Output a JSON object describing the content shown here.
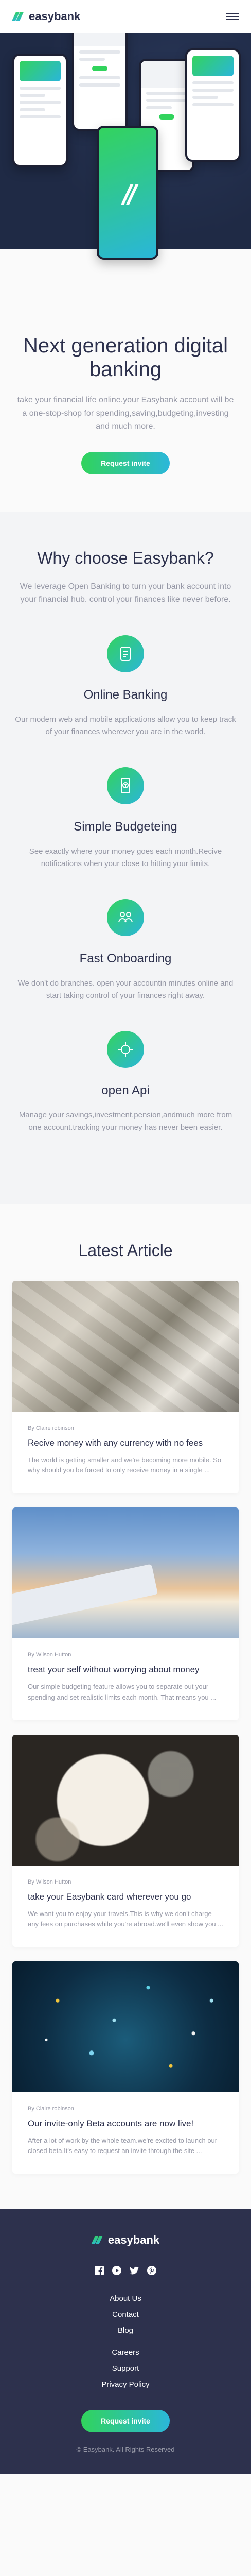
{
  "header": {
    "logo_text": "easybank",
    "menu_icon": "hamburger-menu-icon"
  },
  "hero": {
    "title": "Next generation digital banking",
    "description": "take your financial life online.your Easybank account will be a one-stop-shop for spending,saving,budgeting,investing and much more.",
    "cta_label": "Request invite"
  },
  "why": {
    "title": "Why choose Easybank?",
    "description": "We leverage Open Banking to turn your bank account into your financial hub. control your finances like never before.",
    "features": [
      {
        "icon": "online-banking-icon",
        "title": "Online Banking",
        "text": "Our modern web and mobile applications allow you to keep track of your finances wherever you are in the world."
      },
      {
        "icon": "budgeting-icon",
        "title": "Simple Budgeteing",
        "text": "See exactly where your money goes each month.Recive notifications when your close to hitting your limits."
      },
      {
        "icon": "onboarding-icon",
        "title": "Fast Onboarding",
        "text": "We don't do branches. open your accountin minutes online and start taking control of your finances right away."
      },
      {
        "icon": "api-icon",
        "title": "open Api",
        "text": "Manage your savings,investment,pension,andmuch more from one account.tracking your money has never been easier."
      }
    ]
  },
  "articles": {
    "title": "Latest Article",
    "items": [
      {
        "author": "By Claire robinson",
        "title": "Recive money with any currency with no fees",
        "text": "The world is getting smaller and we're becoming more mobile. So why should you be forced to only receive money in a single ..."
      },
      {
        "author": "By Wilson Hutton",
        "title": "treat your self without worrying about money",
        "text": "Our simple budgeting feature allows you to separate out your spending and set realistic limits each month. That means you ..."
      },
      {
        "author": "By Wilson Hutton",
        "title": "take your Easybank card wherever you go",
        "text": "We want you to enjoy your travels.This is why we don't charge any fees on purchases while you're abroad.we'll even show you ..."
      },
      {
        "author": "By Claire robinson",
        "title": "Our invite-only Beta accounts are now live!",
        "text": "After a lot of work by the whole team.we're excited to launch our closed beta.It's easy to request an invite through the site ..."
      }
    ]
  },
  "footer": {
    "logo_text": "easybank",
    "socials": [
      "facebook-icon",
      "youtube-icon",
      "twitter-icon",
      "pinterest-icon"
    ],
    "links_primary": [
      "About Us",
      "Contact",
      "Blog"
    ],
    "links_secondary": [
      "Careers",
      "Support",
      "Privacy Policy"
    ],
    "cta_label": "Request invite",
    "copyright": "© Easybank. All Rights Reserved"
  }
}
